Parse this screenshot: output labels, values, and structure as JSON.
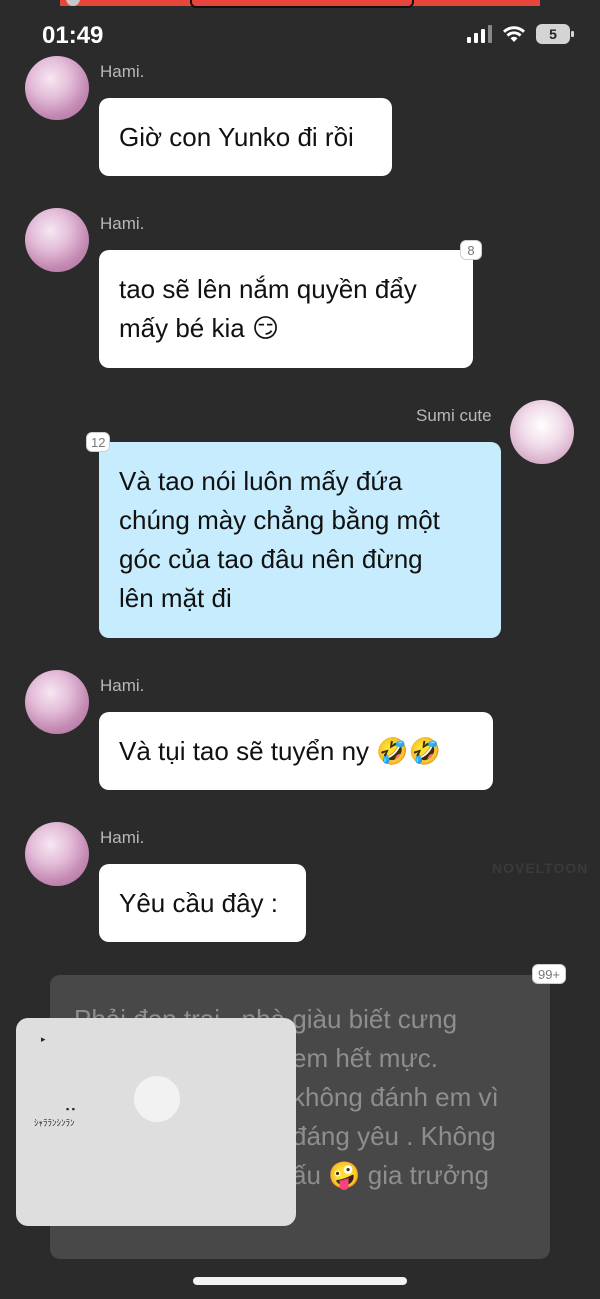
{
  "status": {
    "time": "01:49",
    "battery": "5"
  },
  "messages": [
    {
      "sender": "Hami.",
      "text": "Giờ con Yunko đi rồi"
    },
    {
      "sender": "Hami.",
      "line1": "tao sẽ lên nắm quyền đẩy",
      "line2": "mấy bé kia 😏",
      "badge": "8"
    },
    {
      "sender": "Sumi cute",
      "line1": "Và tao nói luôn mấy đứa",
      "line2": "chúng mày chẳng bằng một",
      "line3": "góc của tao đâu nên đừng",
      "line4": "lên mặt đi",
      "badge": "12"
    },
    {
      "sender": "Hami.",
      "text": "Và tụi tao sẽ tuyển ny 🤣🤣"
    },
    {
      "sender": "Hami.",
      "text": "Yêu cầu đây :"
    },
    {
      "badge": "99+",
      "line1": "Phải đẹp trai , nhà giàu biết cưng",
      "line2": "em hết mực.",
      "line3": "không đánh em vì",
      "line4": "đáng yêu . Không",
      "line5": "ấu 🤪 gia trưởng"
    }
  ],
  "watermark": "NOVELTOON",
  "overlay": {
    "caption": "ｼｬﾗﾗﾝｼﾝﾗﾝ"
  },
  "colors": {
    "background": "#2b2b2b",
    "bubble_white": "#ffffff",
    "bubble_blue": "#c6ecfd",
    "status_bar_accent": "#e8453c"
  }
}
